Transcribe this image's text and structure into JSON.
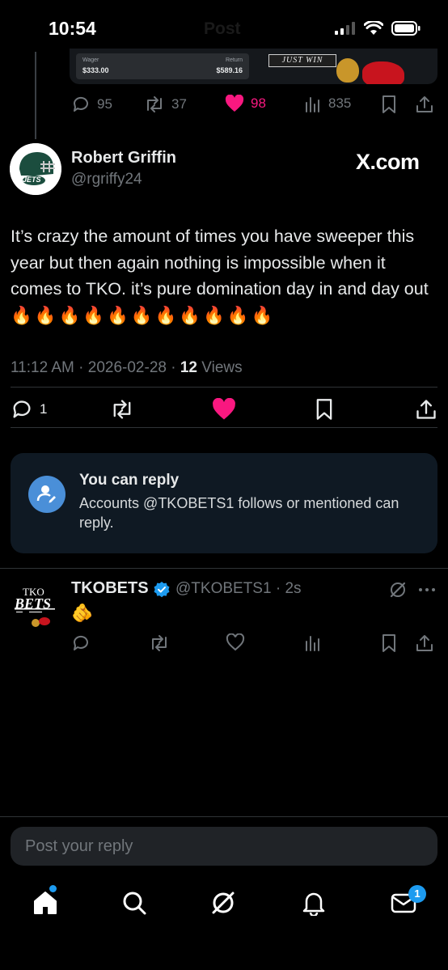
{
  "status_bar": {
    "time": "10:54",
    "ghost_title": "Post"
  },
  "parent_post": {
    "wager_label": "Wager",
    "wager_value": "$333.00",
    "return_label": "Return",
    "return_value": "$589.16",
    "banner_text": "JUST WIN",
    "stats": {
      "replies": "95",
      "reposts": "37",
      "likes": "98",
      "views": "835"
    }
  },
  "post": {
    "author_name": "Robert Griffin",
    "author_handle": "@rgriffy24",
    "avatar_label": "JETS",
    "watermark": "X.com",
    "text": "It’s crazy the amount of times you have sweeper this year but then again nothing is impossible when it comes to TKO. it’s pure domination day in and day out",
    "emoji": "🔥🔥🔥🔥🔥🔥🔥🔥🔥🔥🔥",
    "time": "11:12 AM",
    "date": "2026-02-28",
    "views_count": "12",
    "views_label": "Views",
    "reply_count": "1"
  },
  "reply_restriction": {
    "title": "You can reply",
    "description": "Accounts @TKOBETS1 follows or mentioned can reply."
  },
  "reply": {
    "author_name": "TKOBETS",
    "author_handle": "@TKOBETS1",
    "age": "2s",
    "logo_top": "TKO",
    "logo_main": "BETS",
    "text": "🫵"
  },
  "composer": {
    "placeholder": "Post your reply"
  },
  "nav": {
    "messages_badge": "1"
  },
  "colors": {
    "like_pink": "#f91880",
    "accent_blue": "#1d9bf0",
    "muted": "#71767b"
  }
}
